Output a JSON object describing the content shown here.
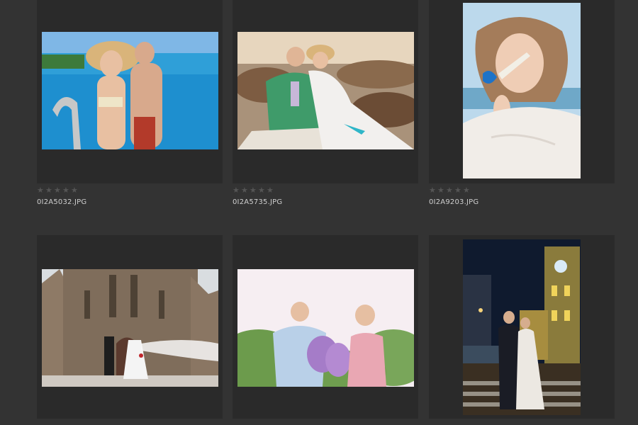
{
  "thumbnails": [
    {
      "filename": "0I2A5032.JPG",
      "rating": 0,
      "max_rating": 5,
      "orientation": "landscape"
    },
    {
      "filename": "0I2A5735.JPG",
      "rating": 0,
      "max_rating": 5,
      "orientation": "landscape"
    },
    {
      "filename": "0I2A9203.JPG",
      "rating": 0,
      "max_rating": 5,
      "orientation": "portrait"
    },
    {
      "filename": "",
      "rating": 0,
      "max_rating": 5,
      "orientation": "landscape"
    },
    {
      "filename": "",
      "rating": 0,
      "max_rating": 5,
      "orientation": "landscape"
    },
    {
      "filename": "",
      "rating": 0,
      "max_rating": 5,
      "orientation": "portrait"
    }
  ],
  "icons": {
    "star": "star-icon"
  },
  "colors": {
    "background": "#333333",
    "frame": "#2a2a2a",
    "star": "#555555",
    "text": "#cfcfcf"
  }
}
